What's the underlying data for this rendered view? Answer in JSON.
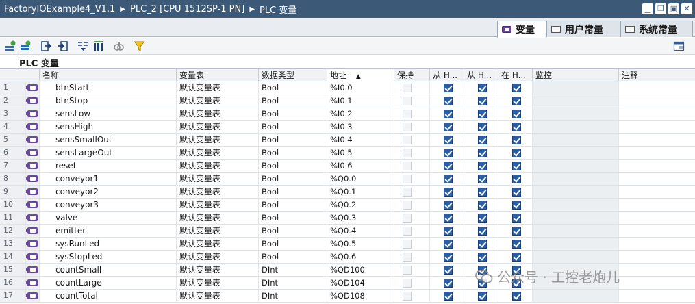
{
  "titlebar": {
    "crumbs": [
      "FactoryIOExample4_V1.1",
      "PLC_2 [CPU 1512SP-1 PN]",
      "PLC 变量"
    ],
    "separator": "▶"
  },
  "tabs": [
    {
      "label": "变量",
      "active": true
    },
    {
      "label": "用户常量",
      "active": false
    },
    {
      "label": "系统常量",
      "active": false
    }
  ],
  "section_title": "PLC 变量",
  "columns": {
    "name": "名称",
    "table": "变量表",
    "type": "数据类型",
    "address": "地址",
    "retain": "保持",
    "hmi1": "从 H...",
    "hmi2": "从 H...",
    "hmi3": "在 H...",
    "monitor": "监控",
    "comment": "注释"
  },
  "rows": [
    {
      "num": "1",
      "name": "btnStart",
      "table": "默认变量表",
      "type": "Bool",
      "address": "%I0.0"
    },
    {
      "num": "2",
      "name": "btnStop",
      "table": "默认变量表",
      "type": "Bool",
      "address": "%I0.1"
    },
    {
      "num": "3",
      "name": "sensLow",
      "table": "默认变量表",
      "type": "Bool",
      "address": "%I0.2"
    },
    {
      "num": "4",
      "name": "sensHigh",
      "table": "默认变量表",
      "type": "Bool",
      "address": "%I0.3"
    },
    {
      "num": "5",
      "name": "sensSmallOut",
      "table": "默认变量表",
      "type": "Bool",
      "address": "%I0.4"
    },
    {
      "num": "6",
      "name": "sensLargeOut",
      "table": "默认变量表",
      "type": "Bool",
      "address": "%I0.5"
    },
    {
      "num": "7",
      "name": "reset",
      "table": "默认变量表",
      "type": "Bool",
      "address": "%I0.6"
    },
    {
      "num": "8",
      "name": "conveyor1",
      "table": "默认变量表",
      "type": "Bool",
      "address": "%Q0.0"
    },
    {
      "num": "9",
      "name": "conveyor2",
      "table": "默认变量表",
      "type": "Bool",
      "address": "%Q0.1"
    },
    {
      "num": "10",
      "name": "conveyor3",
      "table": "默认变量表",
      "type": "Bool",
      "address": "%Q0.2"
    },
    {
      "num": "11",
      "name": "valve",
      "table": "默认变量表",
      "type": "Bool",
      "address": "%Q0.3"
    },
    {
      "num": "12",
      "name": "emitter",
      "table": "默认变量表",
      "type": "Bool",
      "address": "%Q0.4"
    },
    {
      "num": "13",
      "name": "sysRunLed",
      "table": "默认变量表",
      "type": "Bool",
      "address": "%Q0.5"
    },
    {
      "num": "14",
      "name": "sysStopLed",
      "table": "默认变量表",
      "type": "Bool",
      "address": "%Q0.6"
    },
    {
      "num": "15",
      "name": "countSmall",
      "table": "默认变量表",
      "type": "DInt",
      "address": "%QD100"
    },
    {
      "num": "16",
      "name": "countLarge",
      "table": "默认变量表",
      "type": "DInt",
      "address": "%QD104"
    },
    {
      "num": "17",
      "name": "countTotal",
      "table": "默认变量表",
      "type": "DInt",
      "address": "%QD108"
    }
  ],
  "watermark": "公众号 · 工控老炮儿",
  "colors": {
    "titlebar": "#3c5a78",
    "checkbox_on": "#2a5fa8",
    "var_icon": "#6a4a9a"
  }
}
